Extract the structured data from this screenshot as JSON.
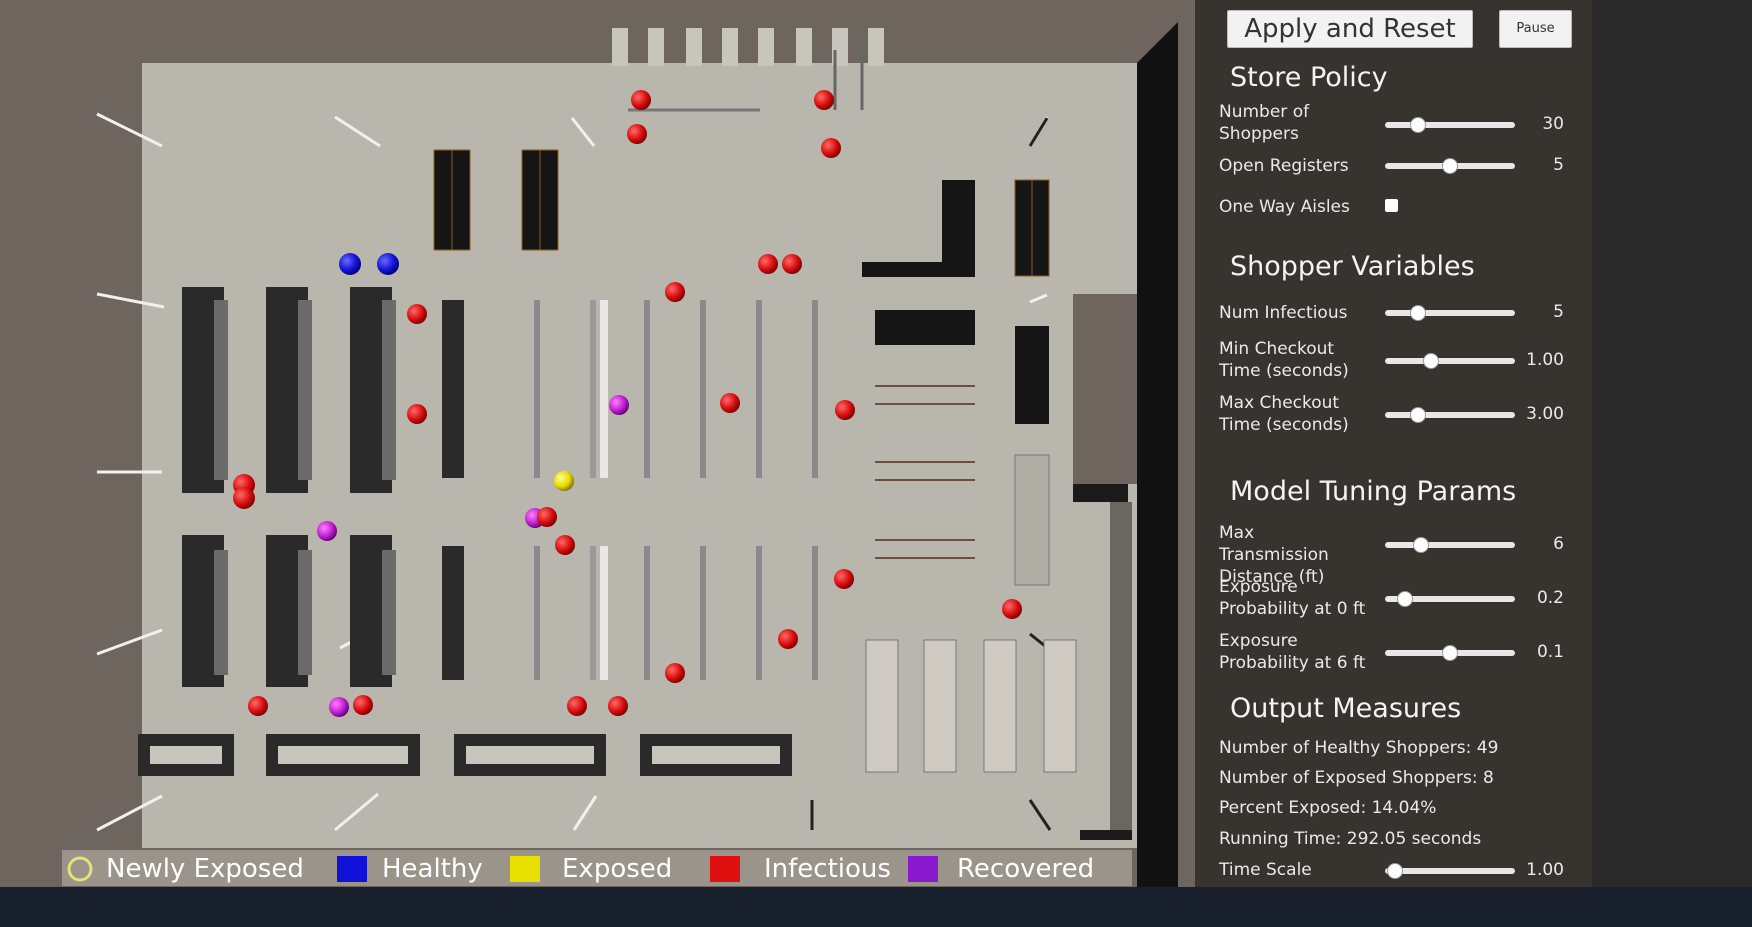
{
  "controls": {
    "apply_label": "Apply and Reset",
    "pause_label": "Pause"
  },
  "store_policy": {
    "title": "Store Policy",
    "shoppers": {
      "label": "Number of Shoppers",
      "value": "30",
      "fraction": 0.25
    },
    "registers": {
      "label": "Open Registers",
      "value": "5",
      "fraction": 0.5
    },
    "one_way": {
      "label": "One Way Aisles",
      "checked": false
    }
  },
  "shopper_vars": {
    "title": "Shopper Variables",
    "num_infectious": {
      "label": "Num Infectious",
      "value": "5",
      "fraction": 0.25
    },
    "min_checkout": {
      "label": "Min Checkout Time (seconds)",
      "value": "1.00",
      "fraction": 0.35
    },
    "max_checkout": {
      "label": "Max Checkout Time (seconds)",
      "value": "3.00",
      "fraction": 0.25
    }
  },
  "model_params": {
    "title": "Model Tuning Params",
    "max_dist": {
      "label": "Max Transmission Distance (ft)",
      "value": "6",
      "fraction": 0.28
    },
    "prob0": {
      "label": "Exposure Probability at 0 ft",
      "value": "0.2",
      "fraction": 0.15
    },
    "prob6": {
      "label": "Exposure Probability at 6 ft",
      "value": "0.1",
      "fraction": 0.5
    }
  },
  "output": {
    "title": "Output Measures",
    "healthy": "Number of Healthy Shoppers: 49",
    "exposed": "Number of Exposed Shoppers: 8",
    "percent": "Percent Exposed: 14.04%",
    "running": "Running Time: 292.05 seconds",
    "time_scale": {
      "label": "Time Scale",
      "value": "1.00",
      "fraction": 0.08
    }
  },
  "legend": [
    {
      "label": "Newly Exposed",
      "color": "#9a948a",
      "ring": "#e6e07a"
    },
    {
      "label": "Healthy",
      "color": "#1010d8"
    },
    {
      "label": "Exposed",
      "color": "#e8e000"
    },
    {
      "label": "Infectious",
      "color": "#e01010"
    },
    {
      "label": "Recovered",
      "color": "#8a1ad0"
    }
  ],
  "colors": {
    "healthy": "#1414d8",
    "exposed": "#e6dc00",
    "infectious": "#e01212",
    "recovered": "#b020c8",
    "floor": "#b9b6ad",
    "wall": "#6e665e",
    "shelf": "#232323",
    "panel": "#37332f"
  }
}
